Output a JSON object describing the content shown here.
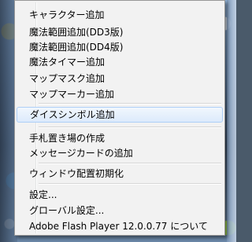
{
  "context_menu": {
    "items": [
      {
        "label": "キャラクター追加"
      },
      {
        "label": "魔法範囲追加(DD3版)"
      },
      {
        "label": "魔法範囲追加(DD4版)"
      },
      {
        "label": "魔法タイマー追加"
      },
      {
        "label": "マップマスク追加"
      },
      {
        "label": "マップマーカー追加"
      },
      {
        "label": "ダイスシンボル追加"
      },
      {
        "label": "手札置き場の作成"
      },
      {
        "label": "メッセージカードの追加"
      },
      {
        "label": "ウィンドウ配置初期化"
      },
      {
        "label": "設定..."
      },
      {
        "label": "グローバル設定..."
      },
      {
        "label": "Adobe Flash Player 12.0.0.77 について"
      }
    ]
  }
}
